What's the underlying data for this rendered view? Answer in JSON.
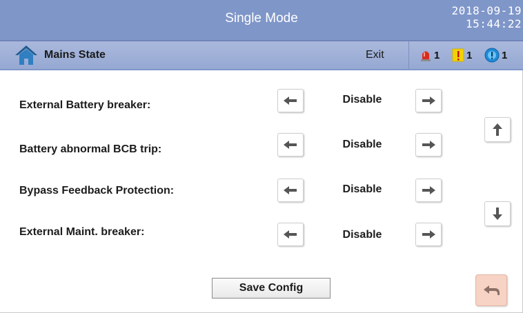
{
  "header": {
    "title": "Single Mode",
    "date": "2018-09-19",
    "time": "15:44:22"
  },
  "nav": {
    "home_icon": "home-icon",
    "title": "Mains State",
    "exit_label": "Exit",
    "alarms": [
      {
        "icon": "red-alarm-icon",
        "count": "1",
        "color": "#d92b1f"
      },
      {
        "icon": "yellow-warning-icon",
        "count": "1",
        "color": "#f2d100"
      },
      {
        "icon": "blue-info-icon",
        "count": "1",
        "color": "#1c8ad8"
      }
    ]
  },
  "settings": [
    {
      "label": "External Battery breaker:",
      "value": "Disable"
    },
    {
      "label": "Battery abnormal BCB trip:",
      "value": "Disable"
    },
    {
      "label": "Bypass Feedback Protection:",
      "value": "Disable"
    },
    {
      "label": "External Maint.  breaker:",
      "value": "Disable"
    }
  ],
  "controls": {
    "save_label": "Save Config",
    "scroll_up_icon": "arrow-up-icon",
    "scroll_down_icon": "arrow-down-icon",
    "back_icon": "return-arrow-icon"
  },
  "colors": {
    "titlebar": "#7f96c9",
    "navbar": "#9fb0d8",
    "back_button": "#f6d3c4"
  }
}
